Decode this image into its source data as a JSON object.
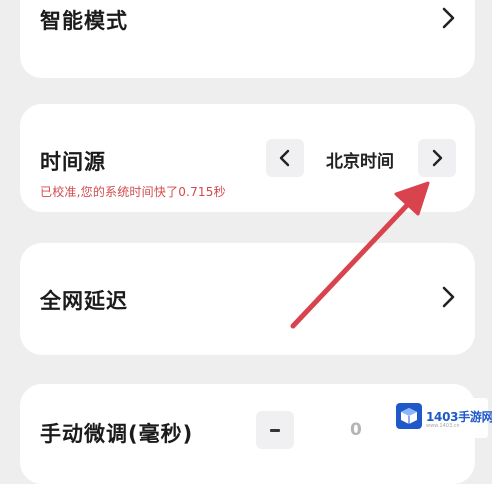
{
  "settings": {
    "smart_mode": {
      "label": "智能模式"
    },
    "time_source": {
      "label": "时间源",
      "value": "北京时间",
      "status": "已校准,您的系统时间快了0.715秒"
    },
    "network_delay": {
      "label": "全网延迟"
    },
    "manual_adjust": {
      "label": "手动微调(毫秒)",
      "value": "0"
    }
  },
  "watermark": {
    "text": "1403手游网",
    "subtext": "www.1403.cn"
  },
  "colors": {
    "background": "#eeeeef",
    "card": "#ffffff",
    "status_text": "#d24b4b",
    "annotation_arrow": "#d9434e",
    "watermark_blue": "#1f58c8"
  },
  "icons": {
    "chevron_right": "chevron-right-icon",
    "chevron_left": "chevron-left-icon",
    "minus": "minus-icon",
    "annotation_arrow": "annotation-arrow"
  }
}
